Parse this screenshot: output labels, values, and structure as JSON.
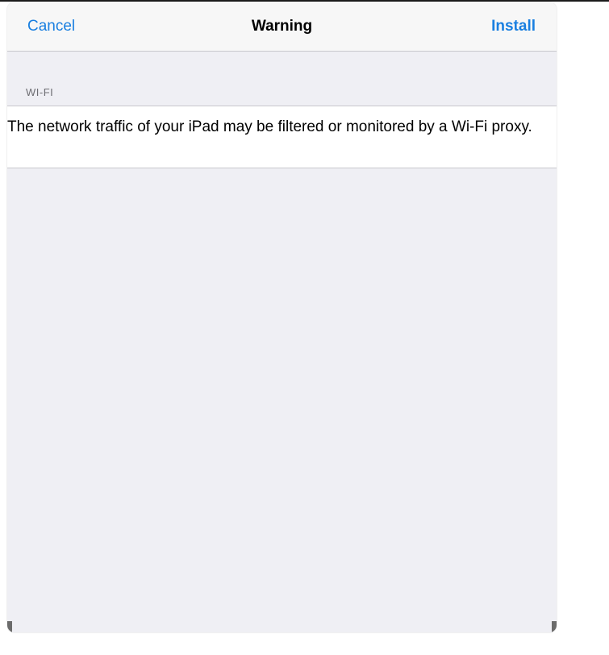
{
  "navbar": {
    "cancel_label": "Cancel",
    "title": "Warning",
    "install_label": "Install"
  },
  "section": {
    "header": "WI-FI",
    "message": "The network traffic of your iPad may be filtered or monitored by a Wi-Fi proxy."
  },
  "colors": {
    "accent": "#1a7fe0",
    "background": "#efeff4",
    "cell": "#ffffff",
    "separator": "#c8c7cc"
  }
}
